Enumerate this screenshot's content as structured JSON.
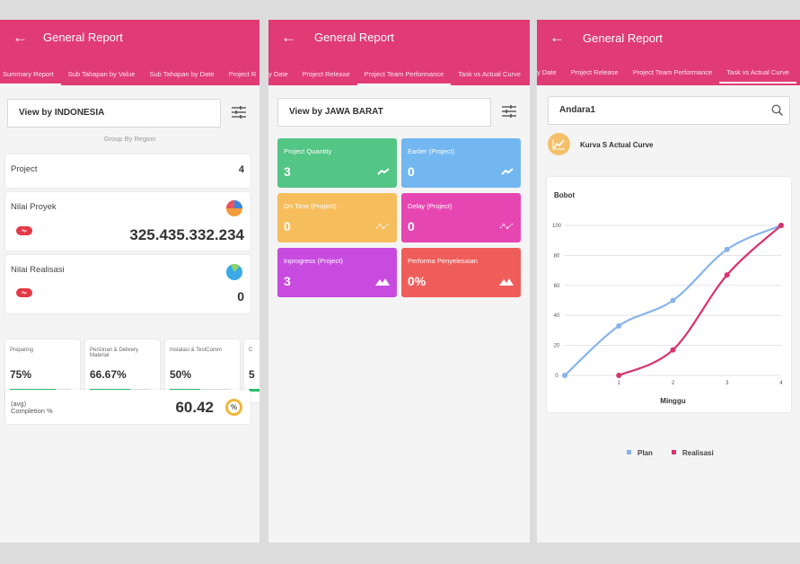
{
  "screens": [
    {
      "title": "General Report",
      "tabs": [
        "Summary Report",
        "Sub Tahapan by Value",
        "Sub Tahapan by Date",
        "Project R"
      ],
      "view_by": "View by INDONESIA",
      "group_by": "Group By Region",
      "project_label": "Project",
      "project_count": "4",
      "nilai_proyek_label": "Nilai Proyek",
      "nilai_proyek_value": "325.435.332.234",
      "nilai_realisasi_label": "Nilai Realisasi",
      "nilai_realisasi_value": "0",
      "currency": "Rp",
      "stages": [
        {
          "label": "Preparing",
          "value": "75%",
          "progress": 0.75
        },
        {
          "label": "Perizinan & Delivery Material",
          "value": "66.67%",
          "progress": 0.6667
        },
        {
          "label": "Instalasi & TestComm",
          "value": "50%",
          "progress": 0.5
        },
        {
          "label": "C",
          "value": "5",
          "progress": 0.5
        }
      ],
      "completion_label_1": "(avg)",
      "completion_label_2": "Completion %",
      "completion_value": "60.42",
      "completion_icon_text": "%"
    },
    {
      "title": "General Report",
      "tabs": [
        "y Date",
        "Project Release",
        "Project Team Performance",
        "Task vs Actual Curve"
      ],
      "view_by": "View by JAWA BARAT",
      "tiles": [
        {
          "label": "Project Quantity",
          "value": "3",
          "color": "#53c585",
          "icon": "trend-up-icon"
        },
        {
          "label": "Earlier (Project)",
          "value": "0",
          "color": "#72b7f0",
          "icon": "trend-up-icon"
        },
        {
          "label": "On Time (Project)",
          "value": "0",
          "color": "#f6bd5c",
          "icon": "trend-line-icon"
        },
        {
          "label": "Delay (Project)",
          "value": "0",
          "color": "#e646b2",
          "icon": "trend-line-icon"
        },
        {
          "label": "Inprogress (Project)",
          "value": "3",
          "color": "#c84be0",
          "icon": "mountain-icon"
        },
        {
          "label": "Performa Penyelesaian",
          "value": "0%",
          "color": "#ef5d5a",
          "icon": "mountain-icon"
        }
      ]
    },
    {
      "title": "General Report",
      "tabs": [
        "y Date",
        "Project Release",
        "Project Team Performance",
        "Task vs Actual Curve"
      ],
      "search_value": "Andara1",
      "curve_title": "Kurva S Actual Curve"
    }
  ],
  "colors": {
    "appbar": "#e03b75",
    "plan": "#87b4ea",
    "realisasi": "#d8336f"
  },
  "chart_data": {
    "type": "line",
    "ylabel": "Bobot",
    "xlabel": "Minggu",
    "x": [
      0,
      1,
      2,
      3,
      4
    ],
    "x_ticks": [
      "0",
      "1",
      "2",
      "3",
      "4"
    ],
    "ylim": [
      0,
      100
    ],
    "y_ticks": [
      "0",
      "20",
      "40",
      "60",
      "80",
      "100"
    ],
    "grid": true,
    "legend_position": "bottom",
    "series": [
      {
        "name": "Plan",
        "x": [
          0,
          1,
          2,
          3,
          4
        ],
        "values": [
          0,
          33,
          50,
          84,
          100
        ]
      },
      {
        "name": "Realisasi",
        "x": [
          1,
          2,
          3,
          4
        ],
        "values": [
          0,
          17,
          67,
          100
        ]
      }
    ]
  }
}
